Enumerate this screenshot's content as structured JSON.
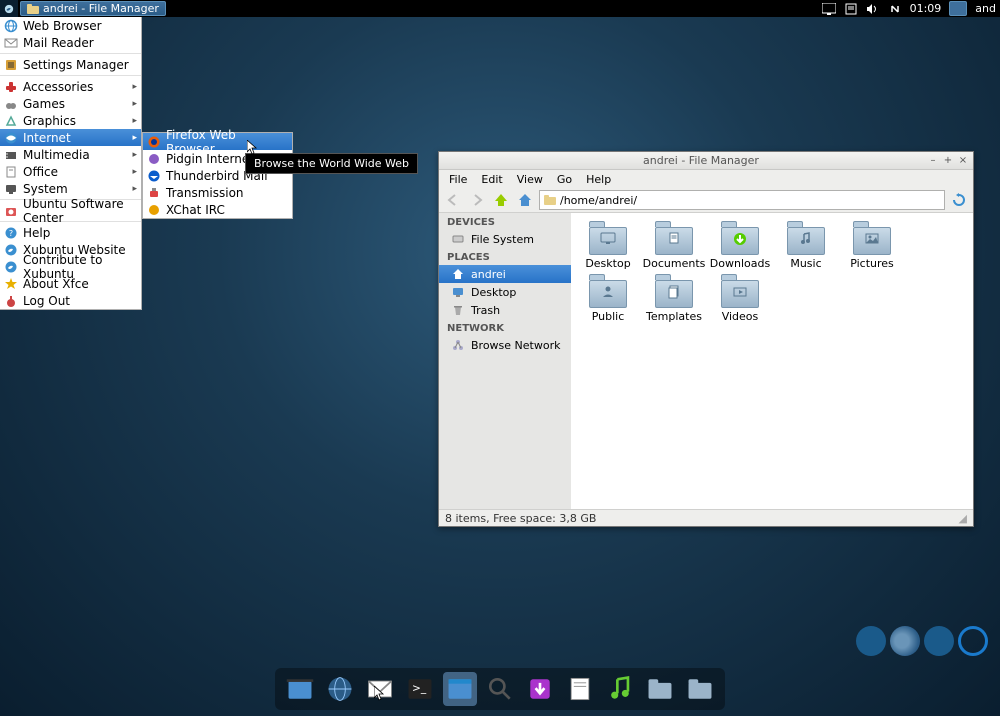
{
  "panel": {
    "taskbar_item": "andrei - File Manager",
    "clock": "01:09",
    "user": "and"
  },
  "appmenu": {
    "items": [
      {
        "label": "Web Browser",
        "icon": "globe"
      },
      {
        "label": "Mail Reader",
        "icon": "mail"
      },
      "-",
      {
        "label": "Settings Manager",
        "icon": "settings"
      },
      "-",
      {
        "label": "Accessories",
        "icon": "accessories",
        "sub": true
      },
      {
        "label": "Games",
        "icon": "games",
        "sub": true
      },
      {
        "label": "Graphics",
        "icon": "graphics",
        "sub": true
      },
      {
        "label": "Internet",
        "icon": "internet",
        "sub": true,
        "hl": true
      },
      {
        "label": "Multimedia",
        "icon": "multimedia",
        "sub": true
      },
      {
        "label": "Office",
        "icon": "office",
        "sub": true
      },
      {
        "label": "System",
        "icon": "system",
        "sub": true
      },
      "-",
      {
        "label": "Ubuntu Software Center",
        "icon": "usc"
      },
      "-",
      {
        "label": "Help",
        "icon": "help"
      },
      {
        "label": "Xubuntu Website",
        "icon": "xubuntu"
      },
      {
        "label": "Contribute to Xubuntu",
        "icon": "xubuntu"
      },
      {
        "label": "About Xfce",
        "icon": "star"
      },
      {
        "label": "Log Out",
        "icon": "logout"
      }
    ]
  },
  "submenu": {
    "items": [
      {
        "label": "Firefox Web Browser",
        "icon": "firefox",
        "hl": true
      },
      {
        "label": "Pidgin Internet Me",
        "icon": "pidgin"
      },
      {
        "label": "Thunderbird Mail",
        "icon": "thunderbird"
      },
      {
        "label": "Transmission",
        "icon": "transmission"
      },
      {
        "label": "XChat IRC",
        "icon": "xchat"
      }
    ]
  },
  "tooltip": "Browse the World Wide Web",
  "fm": {
    "title": "andrei - File Manager",
    "menus": [
      "File",
      "Edit",
      "View",
      "Go",
      "Help"
    ],
    "path": "/home/andrei/",
    "sidebar": {
      "devices_heading": "DEVICES",
      "devices": [
        {
          "label": "File System",
          "icon": "drive"
        }
      ],
      "places_heading": "PLACES",
      "places": [
        {
          "label": "andrei",
          "icon": "home",
          "sel": true
        },
        {
          "label": "Desktop",
          "icon": "desktop"
        },
        {
          "label": "Trash",
          "icon": "trash"
        }
      ],
      "network_heading": "NETWORK",
      "network": [
        {
          "label": "Browse Network",
          "icon": "network"
        }
      ]
    },
    "folders": [
      {
        "label": "Desktop",
        "badge": "monitor"
      },
      {
        "label": "Documents",
        "badge": "doc"
      },
      {
        "label": "Downloads",
        "badge": "down"
      },
      {
        "label": "Music",
        "badge": "music"
      },
      {
        "label": "Pictures",
        "badge": "pic"
      },
      {
        "label": "Public",
        "badge": "public"
      },
      {
        "label": "Templates",
        "badge": "tmpl"
      },
      {
        "label": "Videos",
        "badge": "video"
      }
    ],
    "status": "8 items, Free space: 3,8 GB"
  },
  "dock": {
    "items": [
      "file-manager",
      "web",
      "mail",
      "terminal",
      "window",
      "search",
      "download",
      "notes",
      "music",
      "folder-docs",
      "folder"
    ]
  }
}
